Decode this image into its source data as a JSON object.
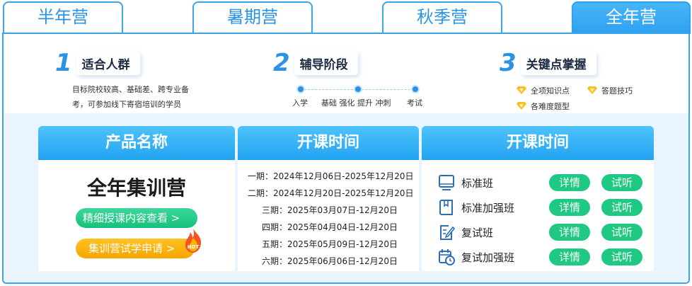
{
  "tabs": [
    "半年营",
    "暑期营",
    "秋季营",
    "全年营"
  ],
  "steps": [
    {
      "num": "1",
      "title": "适合人群",
      "desc_lines": [
        "目标院校较高、基础差、跨专业备",
        "考，可参加线下寄宿培训的学员"
      ]
    },
    {
      "num": "2",
      "title": "辅导阶段",
      "timeline": [
        "入学",
        "基础 强化 提升 冲刺",
        "考试"
      ]
    },
    {
      "num": "3",
      "title": "关键点掌握",
      "features": [
        "全项知识点",
        "答题技巧",
        "各难度题型"
      ]
    }
  ],
  "panels": {
    "product": {
      "header": "产品名称",
      "name": "全年集训营",
      "btn_detail": "精细授课内容查看 >",
      "btn_apply": "集训营试学申请 >",
      "hot": "HOT"
    },
    "schedule": {
      "header": "开课时间",
      "items": [
        "一期：2024年12月06日-2025年12月20日",
        "二期：2024年12月20日-2025年12月20日",
        "三期：2025年03月07日-12月20日",
        "四期：2025年04月04日-12月20日",
        "五期：2025年05月09日-12月20日",
        "六期：2025年06月06日-12月20日"
      ]
    },
    "courses": {
      "header": "开课时间",
      "detail_label": "详情",
      "trial_label": "试听",
      "items": [
        {
          "name": "标准班",
          "icon": "monitor-icon"
        },
        {
          "name": "标准加强班",
          "icon": "book-icon"
        },
        {
          "name": "复试班",
          "icon": "edit-document-icon"
        },
        {
          "name": "复试加强班",
          "icon": "calendar-clock-icon"
        }
      ]
    }
  },
  "colors": {
    "accent": "#2a93e4",
    "green": "#1fc984",
    "orange": "#f7a400",
    "panel_bg": "#e9f4fd"
  }
}
